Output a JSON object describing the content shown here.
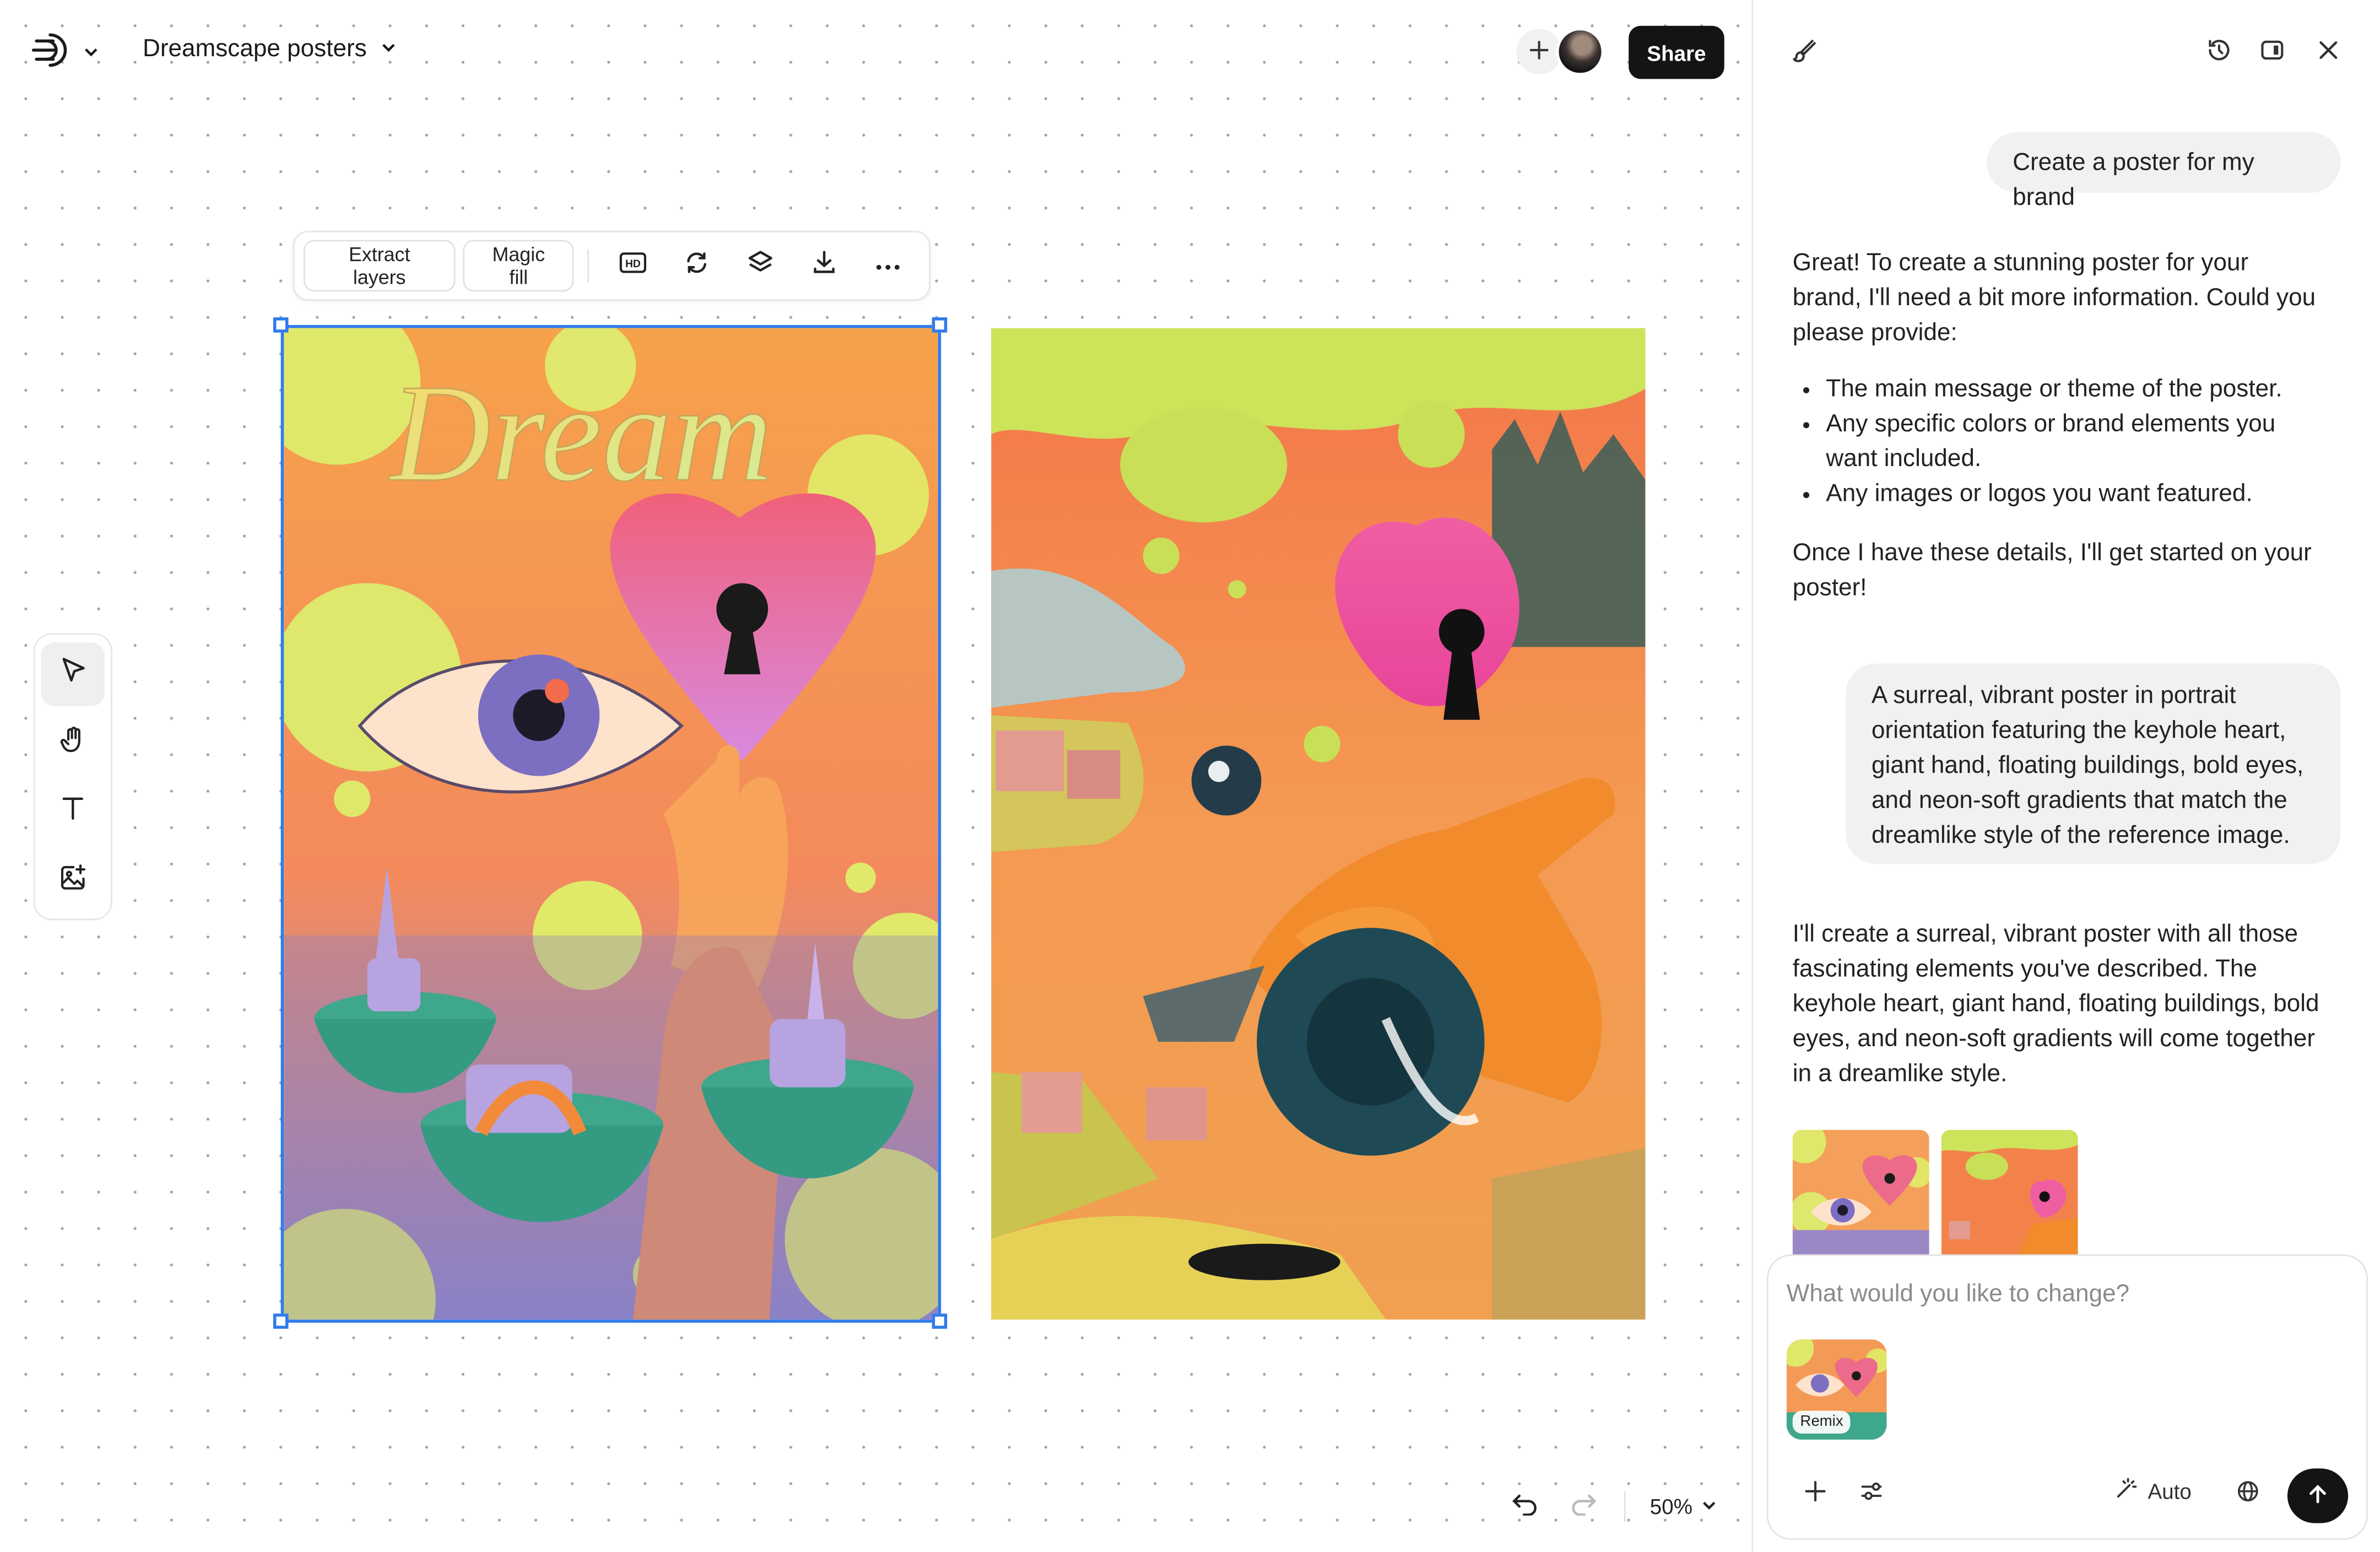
{
  "header": {
    "project_title": "Dreamscape posters",
    "share_label": "Share",
    "logo_icon": "brand-logo-icon",
    "avatar_icon": "user-avatar"
  },
  "toolbar": {
    "extract_layers_label": "Extract layers",
    "magic_fill_label": "Magic fill",
    "icons": [
      "hd-icon",
      "regenerate-icon",
      "layers-icon",
      "download-icon",
      "more-icon"
    ]
  },
  "canvas": {
    "images": [
      {
        "title": "Dream",
        "selected": true
      },
      {
        "title": "",
        "selected": false
      }
    ]
  },
  "left_tools": [
    "pointer-icon",
    "hand-icon",
    "text-icon",
    "add-image-icon"
  ],
  "bottom_controls": {
    "zoom_label": "50%"
  },
  "panel": {
    "icons": [
      "brush-icon",
      "history-icon",
      "panel-toggle-icon",
      "close-icon"
    ],
    "messages": [
      {
        "role": "user",
        "text": "Create a poster for my brand"
      },
      {
        "role": "assistant",
        "intro": "Great! To create a stunning poster for your brand, I'll need a bit more information. Could you please provide:",
        "bullets": [
          "The main message or theme of the poster.",
          "Any specific colors or brand elements you want included.",
          "Any images or logos you want featured."
        ],
        "outro": "Once I have these details, I'll get started on your poster!"
      },
      {
        "role": "user",
        "text": "A surreal, vibrant poster in portrait orientation featuring the keyhole heart, giant hand, floating buildings, bold eyes, and neon-soft gradients that match the dreamlike style of the reference image."
      },
      {
        "role": "assistant",
        "text": "I'll create a surreal, vibrant poster with all those fascinating elements you've described. The keyhole heart, giant hand, floating buildings, bold eyes, and neon-soft gradients will come together in a dreamlike style."
      }
    ],
    "composer": {
      "placeholder": "What would you like to change?",
      "remix_label": "Remix",
      "auto_label": "Auto"
    }
  },
  "colors": {
    "accent": "#2f7bea",
    "dark": "#141414"
  }
}
